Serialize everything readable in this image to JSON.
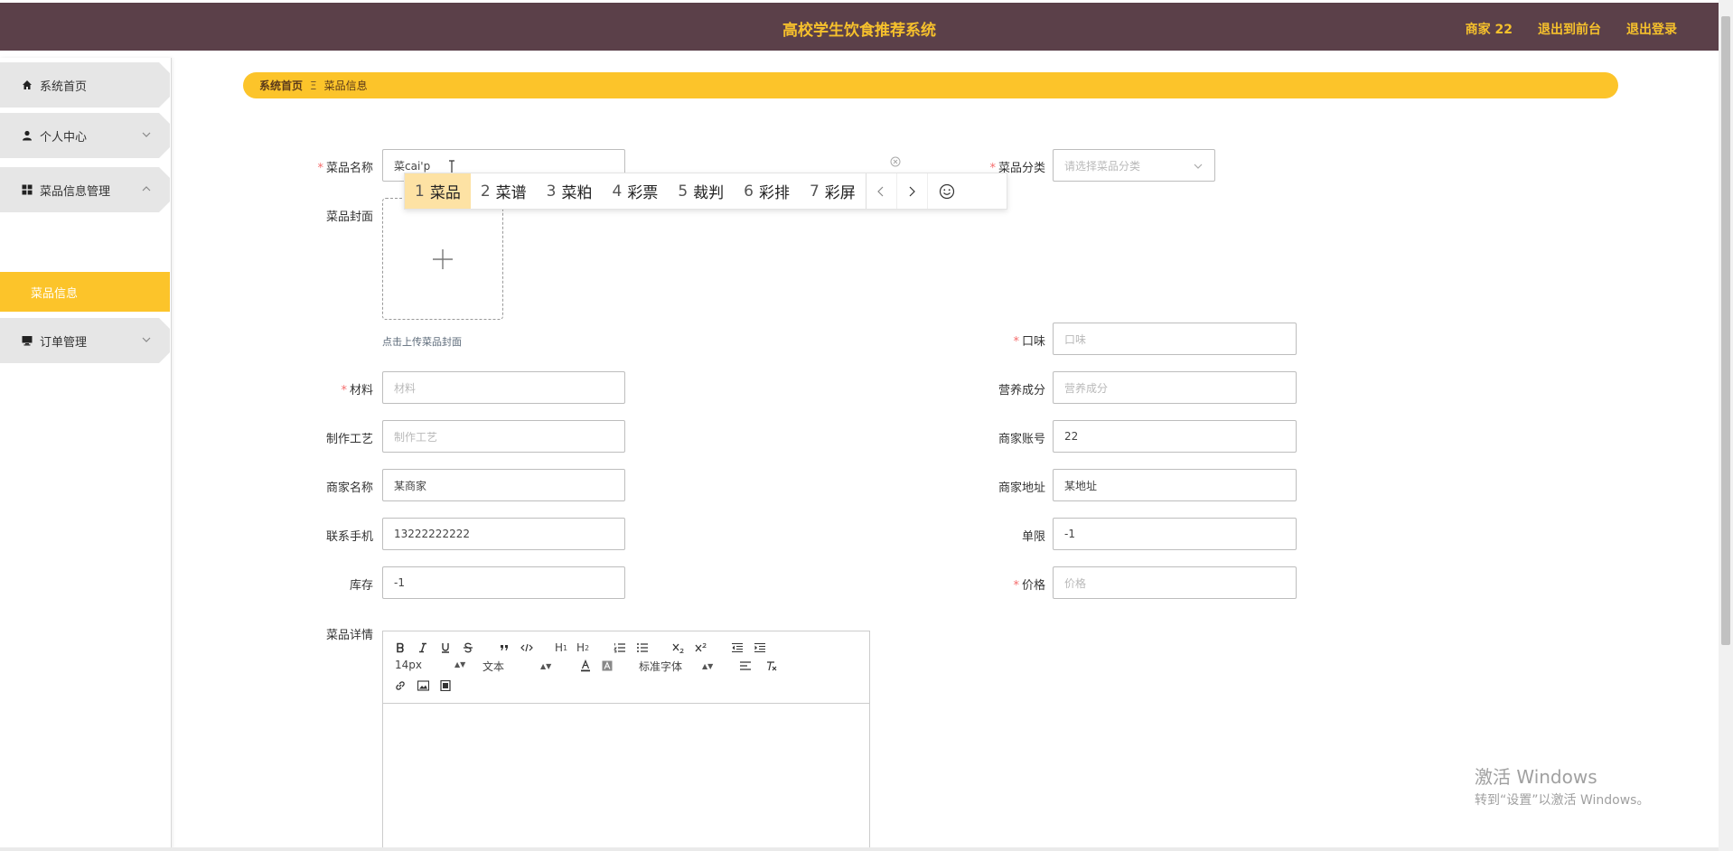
{
  "header": {
    "title": "高校学生饮食推荐系统",
    "user": "商家 22",
    "to_front": "退出到前台",
    "logout": "退出登录"
  },
  "sidebar": {
    "items": [
      {
        "label": "系统首页",
        "icon": "home-icon"
      },
      {
        "label": "个人中心",
        "icon": "user-icon"
      },
      {
        "label": "菜品信息管理",
        "icon": "grid-icon"
      },
      {
        "label": "订单管理",
        "icon": "monitor-icon"
      }
    ],
    "sub_item": "菜品信息"
  },
  "breadcrumb": {
    "home": "系统首页",
    "separator": "Ξ",
    "current": "菜品信息"
  },
  "form": {
    "name": {
      "label": "菜品名称",
      "value": "菜cai'p"
    },
    "category": {
      "label": "菜品分类",
      "placeholder": "请选择菜品分类"
    },
    "cover": {
      "label": "菜品封面",
      "tip": "点击上传菜品封面"
    },
    "taste": {
      "label": "口味",
      "placeholder": "口味"
    },
    "material": {
      "label": "材料",
      "placeholder": "材料"
    },
    "nutrition": {
      "label": "营养成分",
      "placeholder": "营养成分"
    },
    "craft": {
      "label": "制作工艺",
      "placeholder": "制作工艺"
    },
    "merchant_account": {
      "label": "商家账号",
      "value": "22"
    },
    "merchant_name": {
      "label": "商家名称",
      "value": "某商家"
    },
    "merchant_address": {
      "label": "商家地址",
      "value": "某地址"
    },
    "phone": {
      "label": "联系手机",
      "value": "13222222222"
    },
    "limit": {
      "label": "单限",
      "value": "-1"
    },
    "stock": {
      "label": "库存",
      "value": "-1"
    },
    "price": {
      "label": "价格",
      "placeholder": "价格"
    },
    "detail": {
      "label": "菜品详情"
    }
  },
  "ime": {
    "candidates": [
      {
        "n": "1",
        "text": "菜品"
      },
      {
        "n": "2",
        "text": "菜谱"
      },
      {
        "n": "3",
        "text": "菜粕"
      },
      {
        "n": "4",
        "text": "彩票"
      },
      {
        "n": "5",
        "text": "裁判"
      },
      {
        "n": "6",
        "text": "彩排"
      },
      {
        "n": "7",
        "text": "彩屏"
      }
    ]
  },
  "editor": {
    "font_size": "14px",
    "block_format": "文本",
    "font_family": "标准字体",
    "h1": "H",
    "h2": "H"
  },
  "watermark": {
    "line1": "激活 Windows",
    "line2": "转到“设置”以激活 Windows。"
  },
  "colors": {
    "header_bg": "#5b4049",
    "accent": "#fcc42a",
    "header_text": "#f6c12c",
    "required": "#f56c6c"
  }
}
